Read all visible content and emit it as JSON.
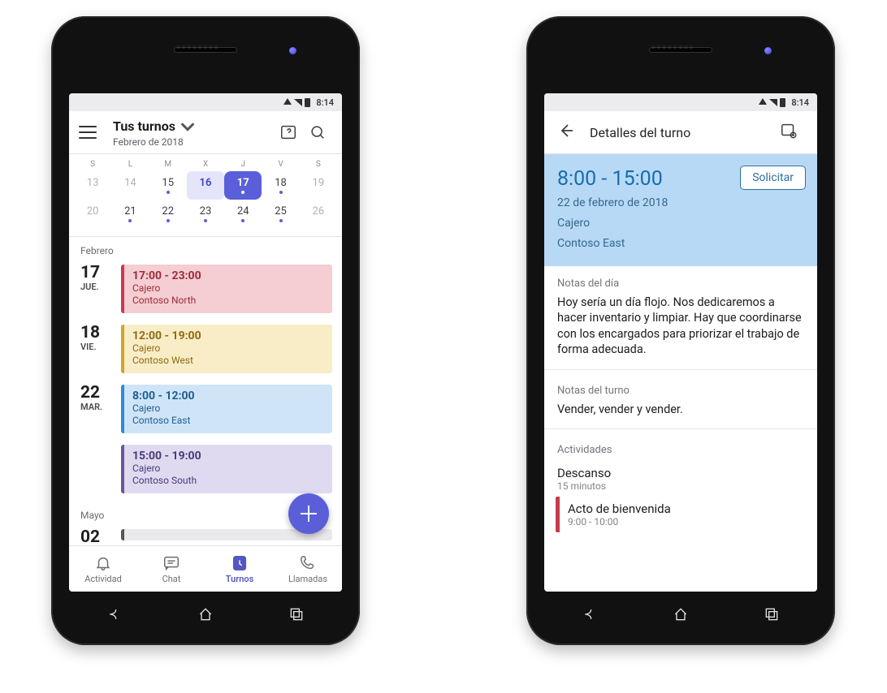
{
  "status": {
    "time": "8:14"
  },
  "left": {
    "title": "Tus turnos",
    "subtitle": "Febrero de 2018",
    "cal": {
      "dow": [
        "S",
        "L",
        "M",
        "X",
        "J",
        "V",
        "S"
      ],
      "rows": [
        [
          {
            "n": "13",
            "dim": true
          },
          {
            "n": "14",
            "dim": true
          },
          {
            "n": "15",
            "dot": true
          },
          {
            "n": "16",
            "today": true
          },
          {
            "n": "17",
            "sel": true,
            "dot": true
          },
          {
            "n": "18",
            "dot": true
          },
          {
            "n": "19",
            "dim": true
          }
        ],
        [
          {
            "n": "20",
            "dim": true
          },
          {
            "n": "21",
            "dot": true
          },
          {
            "n": "22",
            "dot": true
          },
          {
            "n": "23",
            "dot": true
          },
          {
            "n": "24",
            "dot": true
          },
          {
            "n": "25",
            "dot": true
          },
          {
            "n": "26",
            "dim": true
          }
        ]
      ]
    },
    "month_a": "Febrero",
    "shifts": [
      {
        "day": "17",
        "dow": "JUE.",
        "cls": "c-red",
        "time": "17:00 - 23:00",
        "role": "Cajero",
        "loc": "Contoso North"
      },
      {
        "day": "18",
        "dow": "VIE.",
        "cls": "c-yellow",
        "time": "12:00 - 19:00",
        "role": "Cajero",
        "loc": "Contoso West"
      },
      {
        "day": "22",
        "dow": "MAR.",
        "cls": "c-blue",
        "time": "8:00 - 12:00",
        "role": "Cajero",
        "loc": "Contoso East"
      },
      {
        "day": "",
        "dow": "",
        "cls": "c-purple",
        "time": "15:00 - 19:00",
        "role": "Cajero",
        "loc": "Contoso South"
      }
    ],
    "month_b": "Mayo",
    "peek": {
      "day": "02",
      "cls": "c-gray"
    },
    "tabs": [
      {
        "name": "Actividad"
      },
      {
        "name": "Chat"
      },
      {
        "name": "Turnos"
      },
      {
        "name": "Llamadas"
      }
    ]
  },
  "right": {
    "title": "Detalles del turno",
    "hero_time": "8:00 - 15:00",
    "hero_date": "22 de febrero de 2018",
    "hero_role": "Cajero",
    "hero_loc": "Contoso East",
    "solicitar": "Solicitar",
    "notes_day_label": "Notas del día",
    "notes_day": "Hoy sería un día flojo. Nos dedicaremos a hacer inventario y limpiar. Hay que coordinarse con los encargados para priorizar el trabajo de forma adecuada.",
    "notes_shift_label": "Notas del turno",
    "notes_shift": "Vender, vender y vender.",
    "activities_label": "Actividades",
    "acts": [
      {
        "name": "Descanso",
        "sub": "15 minutos",
        "marked": false
      },
      {
        "name": "Acto de bienvenida",
        "sub": "9:00 - 10:00",
        "marked": true
      }
    ]
  }
}
